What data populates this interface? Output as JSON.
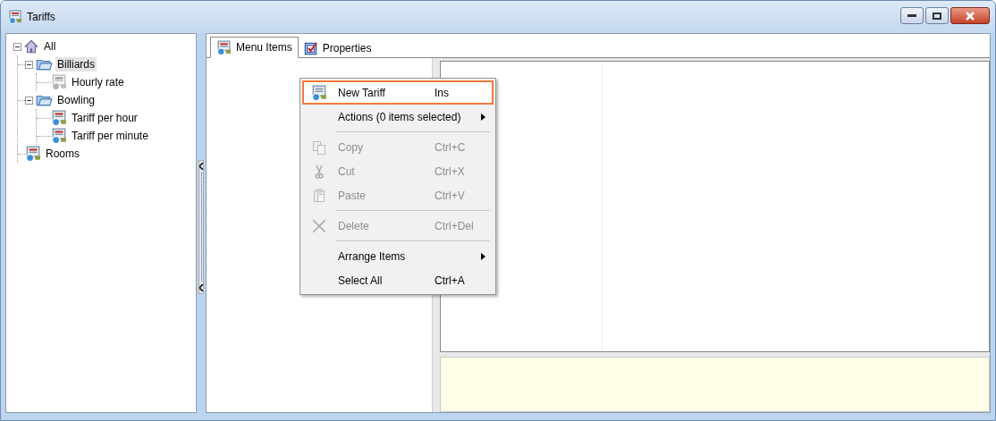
{
  "window": {
    "title": "Tariffs"
  },
  "tree": [
    {
      "label": "All",
      "kind": "root",
      "expanded": true,
      "selected": false,
      "children": [
        {
          "label": "Billiards",
          "kind": "group",
          "expanded": true,
          "selected": true,
          "children": [
            {
              "label": "Hourly rate",
              "kind": "tariff",
              "inactive": true,
              "selected": false
            }
          ]
        },
        {
          "label": "Bowling",
          "kind": "group",
          "expanded": true,
          "selected": false,
          "children": [
            {
              "label": "Tariff per hour",
              "kind": "tariff",
              "inactive": false,
              "selected": false
            },
            {
              "label": "Tariff per minute",
              "kind": "tariff",
              "inactive": false,
              "selected": false
            }
          ]
        },
        {
          "label": "Rooms",
          "kind": "tariff",
          "inactive": false,
          "selected": false
        }
      ]
    }
  ],
  "tabs": [
    {
      "label": "Menu Items",
      "kind": "list",
      "selected": true
    },
    {
      "label": "Properties",
      "kind": "properties",
      "selected": false
    }
  ],
  "context_menu": [
    {
      "kind": "tariff",
      "label": "New Tariff",
      "shortcut": "Ins",
      "disabled": false,
      "highlighted": true,
      "submenu": false
    },
    {
      "kind": "plain",
      "label": "Actions (0 items selected)",
      "disabled": false,
      "highlighted": false,
      "submenu": true
    },
    {
      "kind": "separator"
    },
    {
      "kind": "copy",
      "label": "Copy",
      "shortcut": "Ctrl+C",
      "disabled": true,
      "highlighted": false,
      "submenu": false
    },
    {
      "kind": "cut",
      "label": "Cut",
      "shortcut": "Ctrl+X",
      "disabled": true,
      "highlighted": false,
      "submenu": false
    },
    {
      "kind": "paste",
      "label": "Paste",
      "shortcut": "Ctrl+V",
      "disabled": true,
      "highlighted": false,
      "submenu": false
    },
    {
      "kind": "separator"
    },
    {
      "kind": "delete",
      "label": "Delete",
      "shortcut": "Ctrl+Del",
      "disabled": true,
      "highlighted": false,
      "submenu": false
    },
    {
      "kind": "separator"
    },
    {
      "kind": "plain",
      "label": "Arrange Items",
      "disabled": false,
      "highlighted": false,
      "submenu": true
    },
    {
      "kind": "plain",
      "label": "Select All",
      "shortcut": "Ctrl+A",
      "disabled": false,
      "highlighted": false,
      "submenu": false
    }
  ]
}
